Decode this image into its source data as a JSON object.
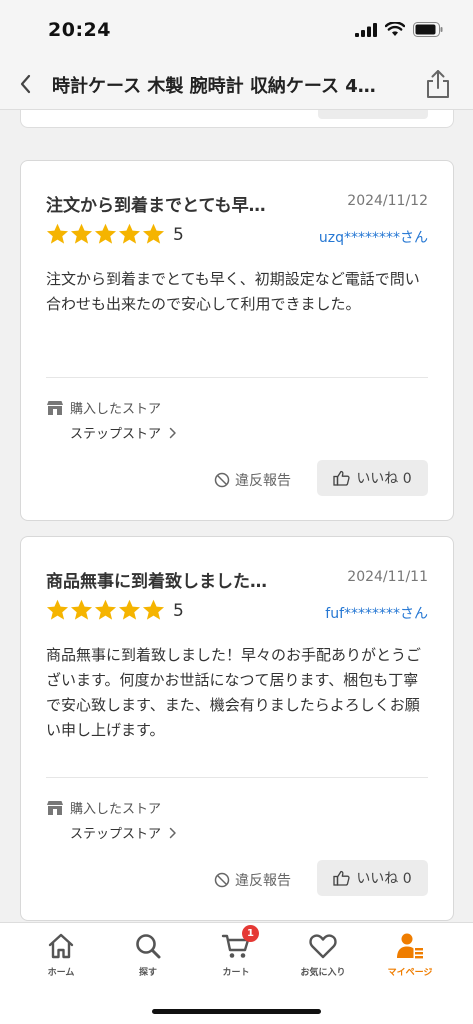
{
  "status_bar": {
    "time": "20:24"
  },
  "nav": {
    "title": "時計ケース 木製 腕時計 収納ケース 4…"
  },
  "reviews": [
    {
      "title": "注文から到着までとても早…",
      "date": "2024/11/12",
      "rating": "5",
      "reviewer": "uzq********さん",
      "body": "注文から到着までとても早く、初期設定など電話で問い合わせも出来たので安心して利用できました。",
      "store_label": "購入したストア",
      "store_name": "ステップストア",
      "report_label": "違反報告",
      "like_label": "いいね 0"
    },
    {
      "title": "商品無事に到着致しました…",
      "date": "2024/11/11",
      "rating": "5",
      "reviewer": "fuf********さん",
      "body": "商品無事に到着致しました！早々のお手配ありがとうございます。何度かお世話になつて居ります、梱包も丁寧で安心致します、また、機会有りましたらよろしくお願い申し上げます。",
      "store_label": "購入したストア",
      "store_name": "ステップストア",
      "report_label": "違反報告",
      "like_label": "いいね 0"
    }
  ],
  "tabs": [
    {
      "label": "ホーム",
      "icon": "home-icon"
    },
    {
      "label": "探す",
      "icon": "search-icon"
    },
    {
      "label": "カート",
      "icon": "cart-icon",
      "badge": "1"
    },
    {
      "label": "お気に入り",
      "icon": "heart-icon"
    },
    {
      "label": "マイページ",
      "icon": "user-icon"
    }
  ],
  "colors": {
    "star": "#f5b400",
    "link": "#2577d3",
    "accent": "#ef7d00",
    "badge": "#e53935"
  }
}
